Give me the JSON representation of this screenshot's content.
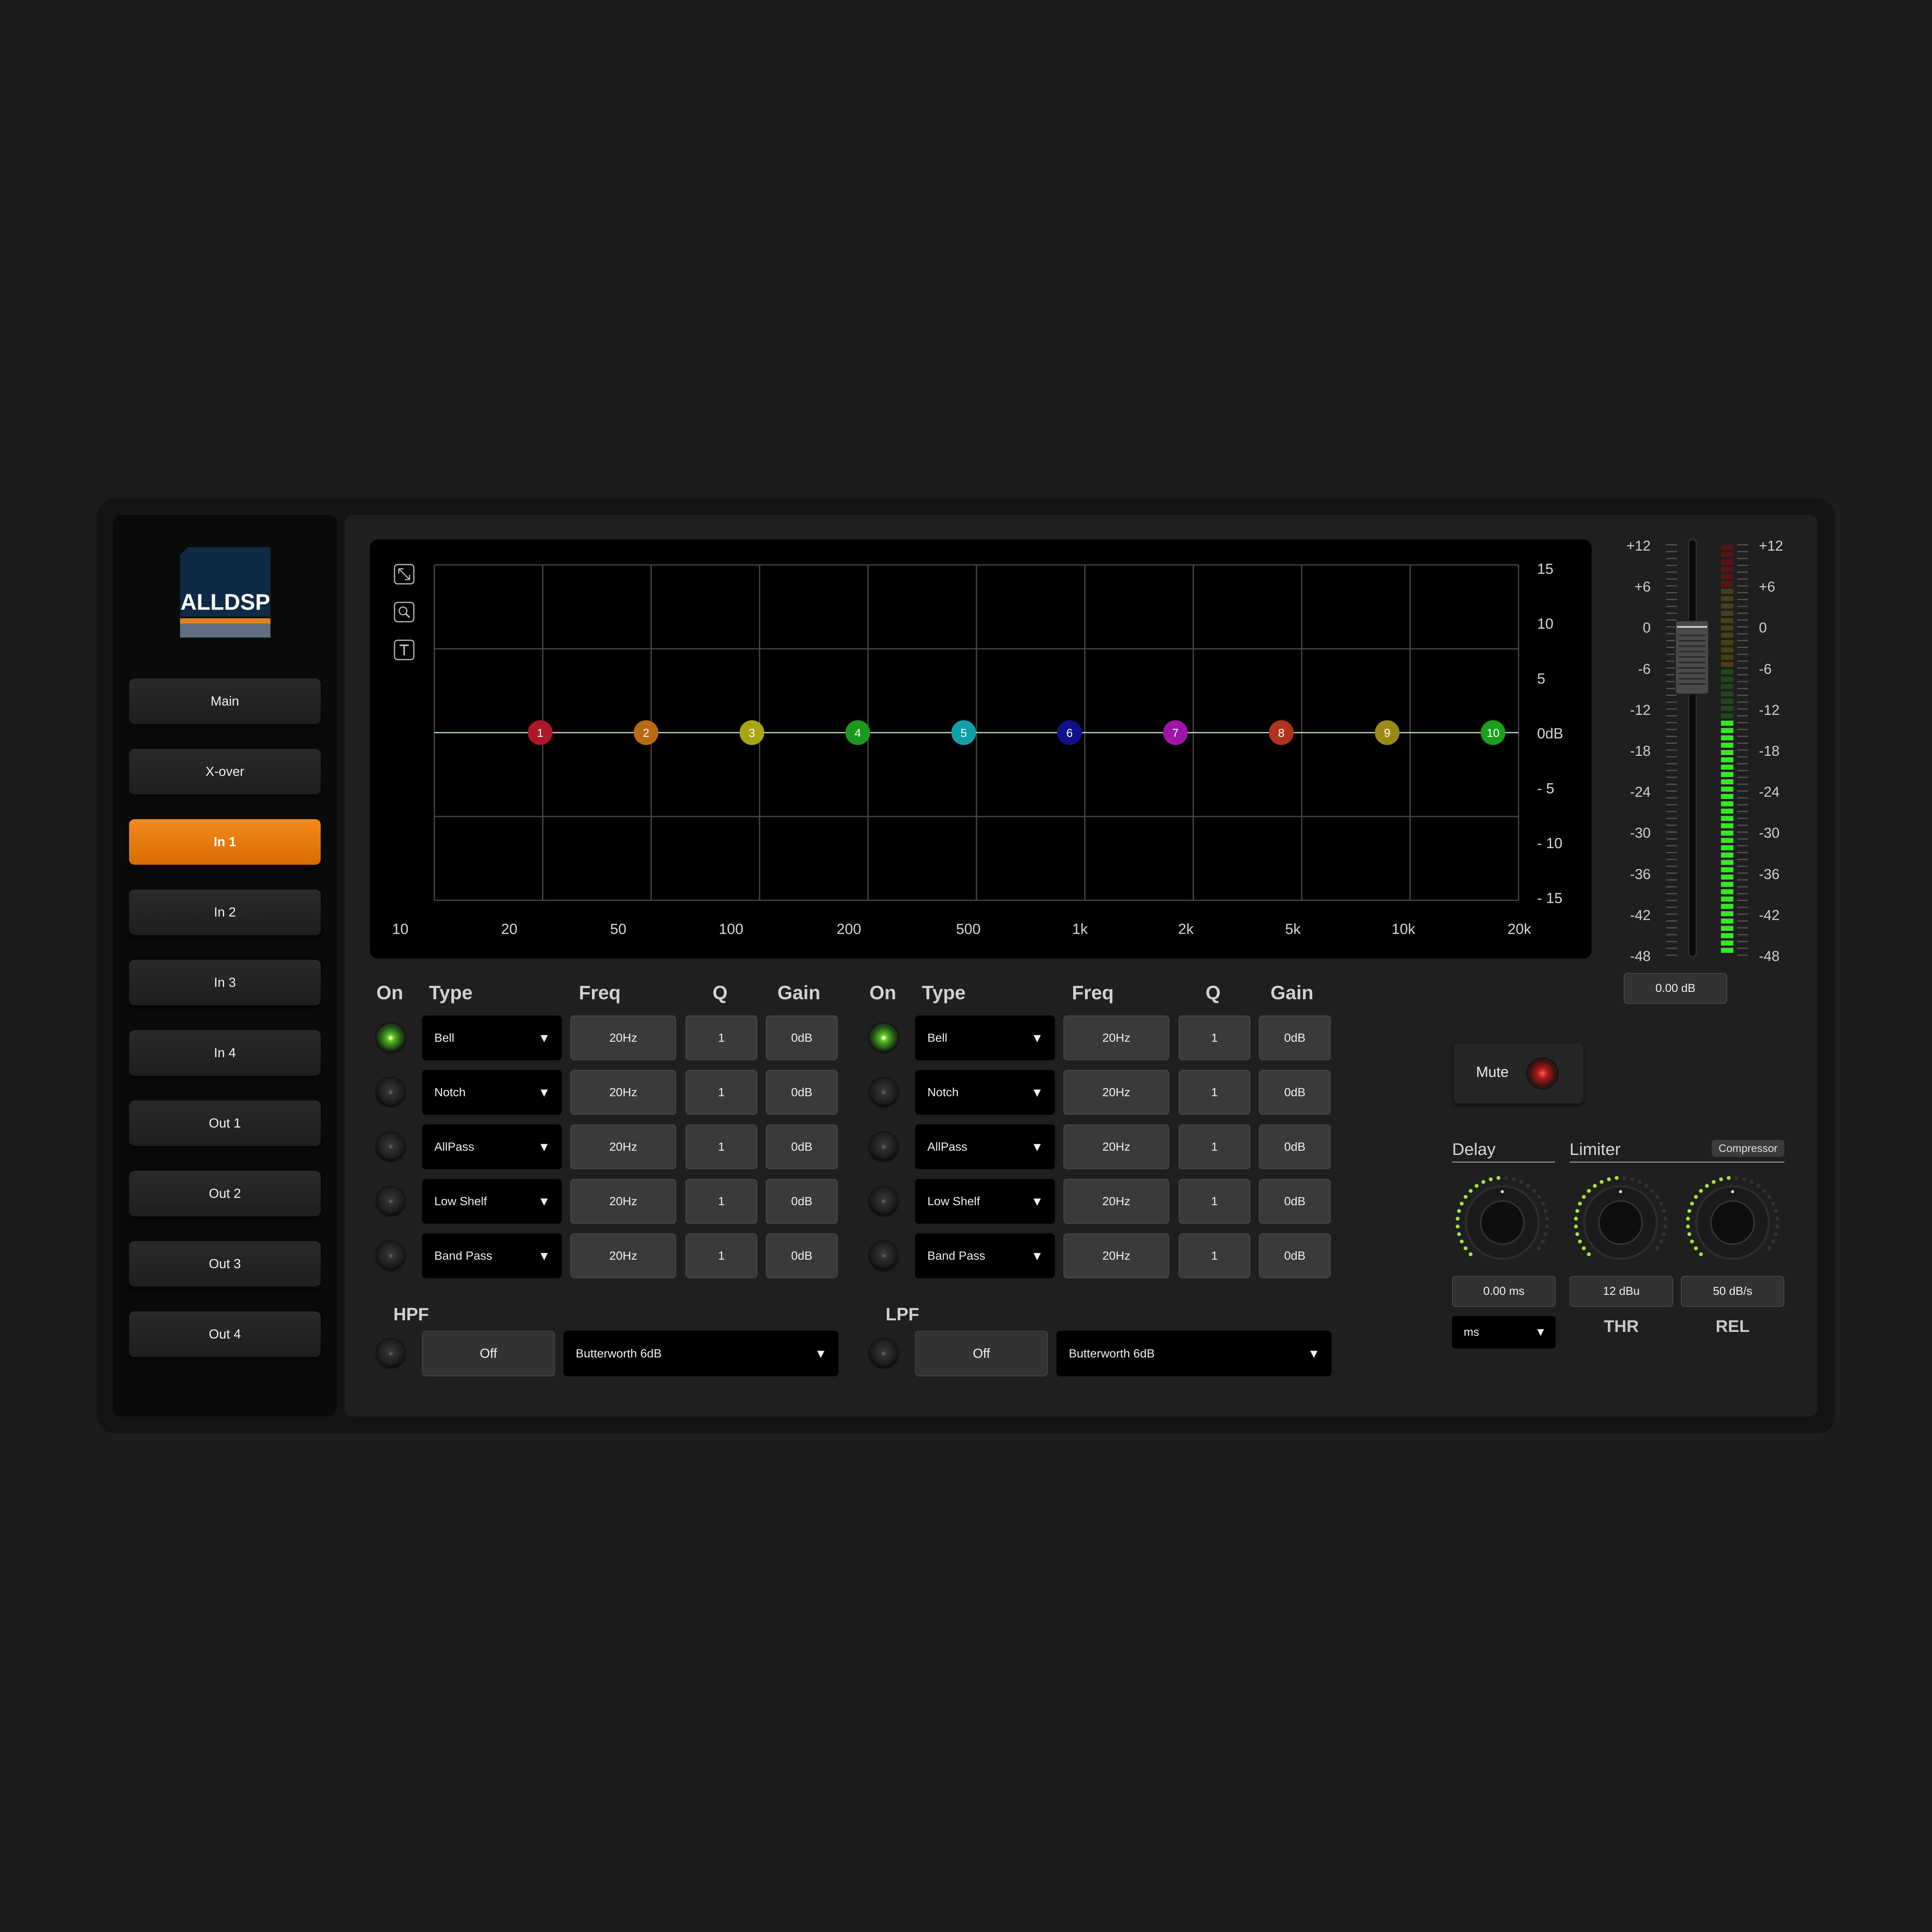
{
  "app": {
    "logo_text": "ALLDSP"
  },
  "nav": {
    "items": [
      {
        "label": "Main",
        "active": false
      },
      {
        "label": "X-over",
        "active": false
      },
      {
        "label": "In 1",
        "active": true
      },
      {
        "label": "In 2",
        "active": false
      },
      {
        "label": "In 3",
        "active": false
      },
      {
        "label": "In 4",
        "active": false
      },
      {
        "label": "Out 1",
        "active": false
      },
      {
        "label": "Out 2",
        "active": false
      },
      {
        "label": "Out 3",
        "active": false
      },
      {
        "label": "Out 4",
        "active": false
      }
    ]
  },
  "graph": {
    "tools": [
      "expand-icon",
      "zoom-icon",
      "text-tool-icon"
    ],
    "freq_ticks": [
      "10",
      "20",
      "50",
      "100",
      "200",
      "500",
      "1k",
      "2k",
      "5k",
      "10k",
      "20k"
    ],
    "db_ticks": [
      "15",
      "10",
      "5",
      "0dB",
      "- 5",
      "- 10",
      "- 15"
    ],
    "bands": [
      {
        "label": "1",
        "color": "#b0162a"
      },
      {
        "label": "2",
        "color": "#b86a12"
      },
      {
        "label": "3",
        "color": "#a8a614"
      },
      {
        "label": "4",
        "color": "#1a9a1a"
      },
      {
        "label": "5",
        "color": "#10a0a8"
      },
      {
        "label": "6",
        "color": "#10108a"
      },
      {
        "label": "7",
        "color": "#a014a8"
      },
      {
        "label": "8",
        "color": "#b0341a"
      },
      {
        "label": "9",
        "color": "#9a8a14"
      },
      {
        "label": "10",
        "color": "#1aa01a"
      }
    ]
  },
  "eq": {
    "headers": {
      "on": "On",
      "type": "Type",
      "freq": "Freq",
      "q": "Q",
      "gain": "Gain"
    },
    "left": [
      {
        "on": true,
        "type": "Bell",
        "freq": "20Hz",
        "q": "1",
        "gain": "0dB"
      },
      {
        "on": false,
        "type": "Notch",
        "freq": "20Hz",
        "q": "1",
        "gain": "0dB"
      },
      {
        "on": false,
        "type": "AllPass",
        "freq": "20Hz",
        "q": "1",
        "gain": "0dB"
      },
      {
        "on": false,
        "type": "Low Shelf",
        "freq": "20Hz",
        "q": "1",
        "gain": "0dB"
      },
      {
        "on": false,
        "type": "Band Pass",
        "freq": "20Hz",
        "q": "1",
        "gain": "0dB"
      }
    ],
    "right": [
      {
        "on": true,
        "type": "Bell",
        "freq": "20Hz",
        "q": "1",
        "gain": "0dB"
      },
      {
        "on": false,
        "type": "Notch",
        "freq": "20Hz",
        "q": "1",
        "gain": "0dB"
      },
      {
        "on": false,
        "type": "AllPass",
        "freq": "20Hz",
        "q": "1",
        "gain": "0dB"
      },
      {
        "on": false,
        "type": "Low Shelf",
        "freq": "20Hz",
        "q": "1",
        "gain": "0dB"
      },
      {
        "on": false,
        "type": "Band Pass",
        "freq": "20Hz",
        "q": "1",
        "gain": "0dB"
      }
    ]
  },
  "hpf": {
    "title": "HPF",
    "state": "Off",
    "type": "Butterworth 6dB"
  },
  "lpf": {
    "title": "LPF",
    "state": "Off",
    "type": "Butterworth 6dB"
  },
  "meter": {
    "scale": [
      "+12",
      "+6",
      "0",
      "-6",
      "-12",
      "-18",
      "-24",
      "-30",
      "-36",
      "-42",
      "-48"
    ],
    "fader_value": "0.00 dB",
    "fader_db": 0,
    "level_db": -13
  },
  "mute": {
    "label": "Mute"
  },
  "delay": {
    "title": "Delay",
    "value": "0.00 ms",
    "unit": "ms"
  },
  "limiter": {
    "title": "Limiter",
    "compressor_label": "Compressor",
    "thr_value": "12 dBu",
    "thr_label": "THR",
    "rel_value": "50 dB/s",
    "rel_label": "REL"
  }
}
